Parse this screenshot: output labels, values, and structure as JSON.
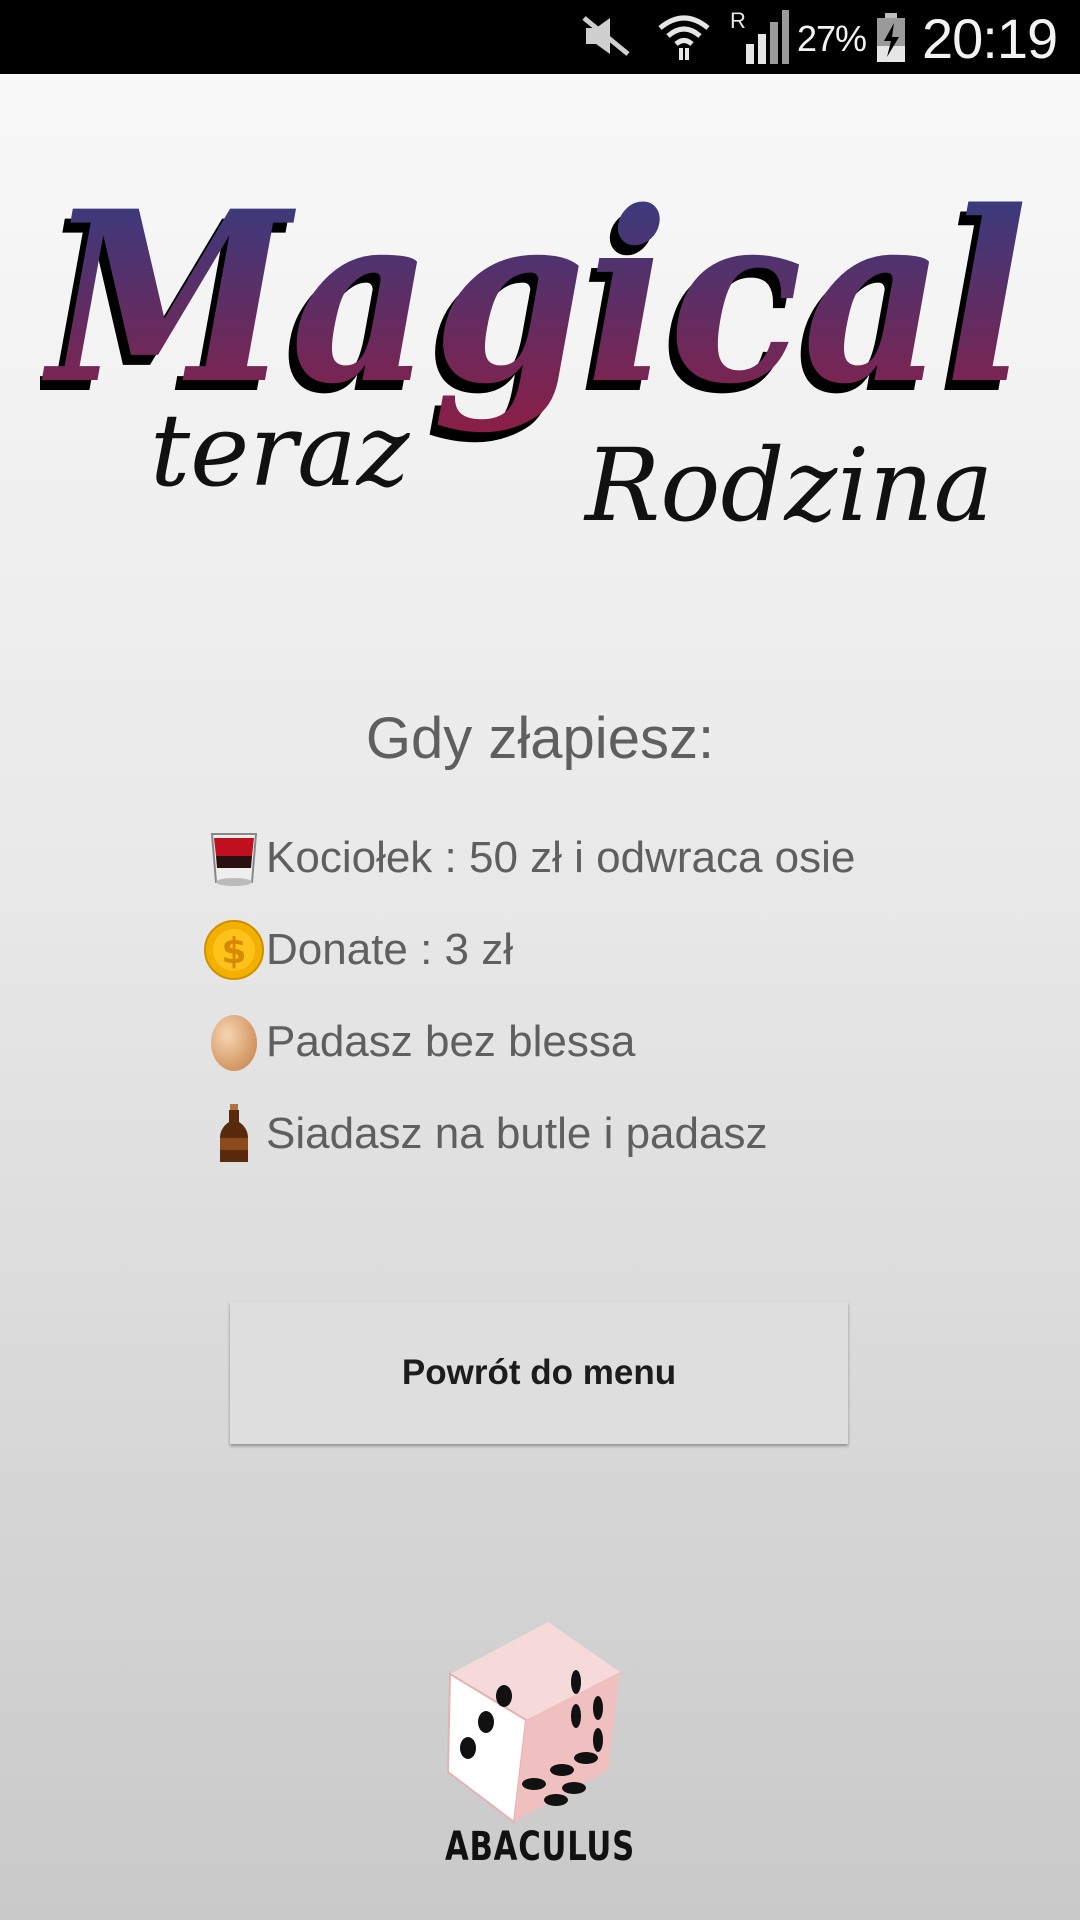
{
  "status_bar": {
    "battery_percent": "27%",
    "time": "20:19",
    "icons": [
      "mute-icon",
      "wifi-icon",
      "roaming-signal-icon",
      "battery-charging-icon"
    ]
  },
  "logo": {
    "title": "Magical",
    "left_word": "teraz",
    "right_word": "Rodzina",
    "colors": [
      "#2d3f86",
      "#8c1e45"
    ]
  },
  "heading": "Gdy złapiesz:",
  "rules": [
    {
      "icon": "kettle-drink-icon",
      "text": "Kociołek : 50 zł i odwraca osie"
    },
    {
      "icon": "gold-coin-icon",
      "text": "Donate : 3 zł"
    },
    {
      "icon": "egg-icon",
      "text": "Padasz bez blessa"
    },
    {
      "icon": "bottle-icon",
      "text": "Siadasz na butle i padasz"
    }
  ],
  "back_button": {
    "label": "Powrót do menu"
  },
  "brand": {
    "name": "ABACULUS",
    "icon": "dice-icon"
  }
}
